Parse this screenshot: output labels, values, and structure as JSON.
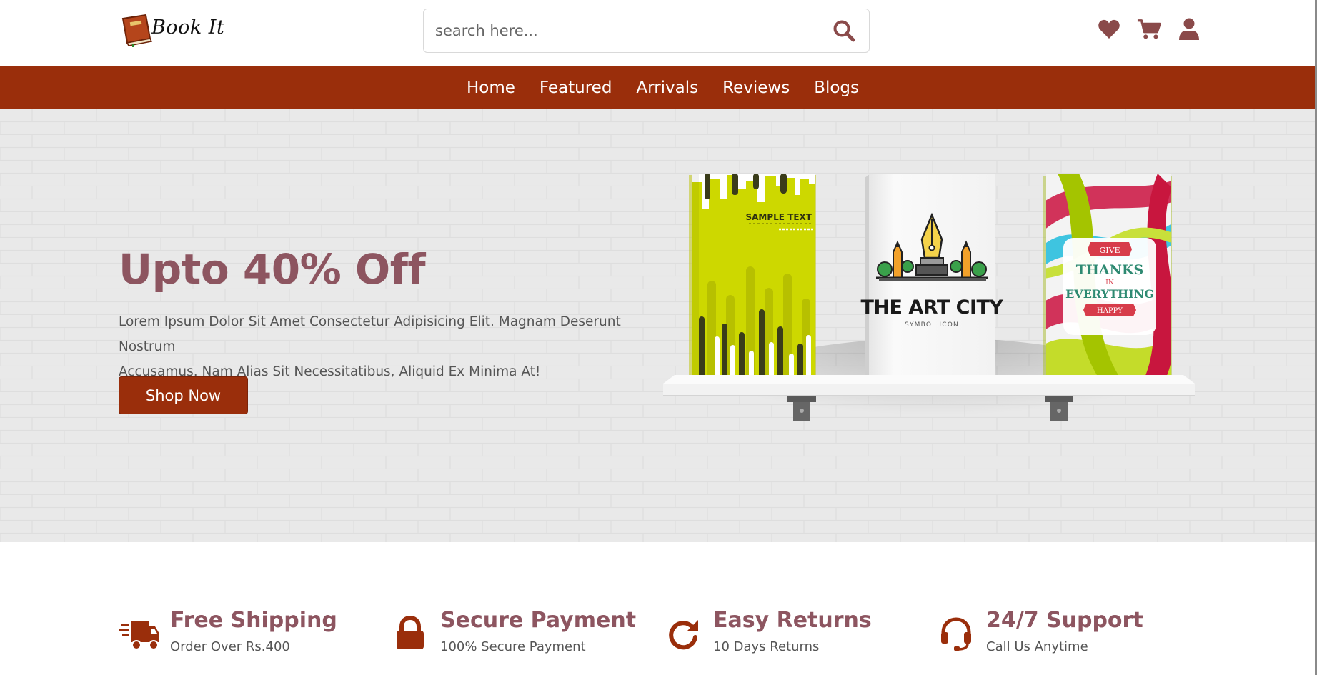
{
  "brand": {
    "name": "Book It"
  },
  "search": {
    "placeholder": "search here..."
  },
  "header_icons": [
    "heart-icon",
    "cart-icon",
    "user-icon"
  ],
  "nav": {
    "links": [
      "Home",
      "Featured",
      "Arrivals",
      "Reviews",
      "Blogs"
    ]
  },
  "hero": {
    "title": "Upto 40% Off",
    "description_line1": "Lorem Ipsum Dolor Sit Amet Consectetur Adipisicing Elit. Magnam Deserunt Nostrum",
    "description_line2": "Accusamus. Nam Alias Sit Necessitatibus, Aliquid Ex Minima At!",
    "cta": "Shop Now",
    "books": [
      {
        "cover_text": "SAMPLE TEXT"
      },
      {
        "cover_title": "THE ART CITY",
        "cover_subtitle": "SYMBOL ICON"
      },
      {
        "cover_line1": "GIVE",
        "cover_line2": "THANKS",
        "cover_line3": "IN",
        "cover_line4": "EVERYTHING",
        "cover_line5": "HAPPY"
      }
    ]
  },
  "features": [
    {
      "title": "Free Shipping",
      "subtitle": "Order Over Rs.400",
      "icon": "truck-icon"
    },
    {
      "title": "Secure Payment",
      "subtitle": "100% Secure Payment",
      "icon": "lock-icon"
    },
    {
      "title": "Easy Returns",
      "subtitle": "10 Days Returns",
      "icon": "redo-icon"
    },
    {
      "title": "24/7 Support",
      "subtitle": "Call Us Anytime",
      "icon": "headset-icon"
    }
  ],
  "colors": {
    "brand": "#9a2e0b",
    "heading": "#8d5560",
    "icon": "#8a4a4a"
  }
}
